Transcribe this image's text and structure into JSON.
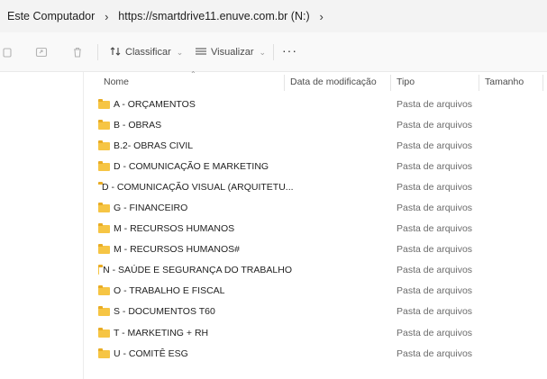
{
  "address": {
    "crumbs": [
      "Este Computador",
      "https://smartdrive11.enuve.com.br (N:)"
    ]
  },
  "toolbar": {
    "sort_label": "Classificar",
    "view_label": "Visualizar",
    "more_label": "···"
  },
  "columns": {
    "name": "Nome",
    "modified": "Data de modificação",
    "type": "Tipo",
    "size": "Tamanho"
  },
  "files": [
    {
      "name": "A - ORÇAMENTOS",
      "type": "Pasta de arquivos"
    },
    {
      "name": "B - OBRAS",
      "type": "Pasta de arquivos"
    },
    {
      "name": "B.2- OBRAS CIVIL",
      "type": "Pasta de arquivos"
    },
    {
      "name": "D - COMUNICAÇÃO E MARKETING",
      "type": "Pasta de arquivos"
    },
    {
      "name": "D - COMUNICAÇÃO VISUAL (ARQUITETU...",
      "type": "Pasta de arquivos"
    },
    {
      "name": "G - FINANCEIRO",
      "type": "Pasta de arquivos"
    },
    {
      "name": "M - RECURSOS HUMANOS",
      "type": "Pasta de arquivos"
    },
    {
      "name": "M - RECURSOS HUMANOS#",
      "type": "Pasta de arquivos"
    },
    {
      "name": "N - SAÚDE E SEGURANÇA DO TRABALHO",
      "type": "Pasta de arquivos"
    },
    {
      "name": "O - TRABALHO E FISCAL",
      "type": "Pasta de arquivos"
    },
    {
      "name": "S - DOCUMENTOS T60",
      "type": "Pasta de arquivos"
    },
    {
      "name": "T - MARKETING + RH",
      "type": "Pasta de arquivos"
    },
    {
      "name": "U - COMITÊ ESG",
      "type": "Pasta de arquivos"
    }
  ],
  "icons": {
    "folder": "folder-icon",
    "copy": "copy-icon",
    "share": "share-icon",
    "delete": "trash-icon",
    "sort": "sort-icon",
    "view": "view-icon",
    "more": "more-icon"
  },
  "colors": {
    "folder": "#f6c544",
    "address_bg": "#f3f3f3",
    "toolbar_bg": "#f9f9f9",
    "type_text": "#6b6b6b"
  }
}
